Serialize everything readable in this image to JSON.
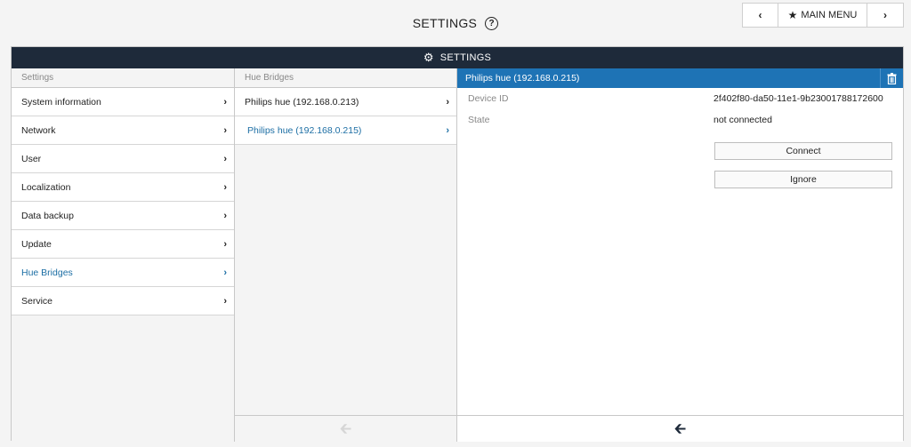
{
  "header": {
    "title": "SETTINGS",
    "help_icon": "?",
    "main_menu_label": "MAIN MENU",
    "prev_icon": "‹",
    "next_icon": "›"
  },
  "bar": {
    "title": "SETTINGS"
  },
  "settings_col": {
    "header": "Settings",
    "items": [
      {
        "label": "System information",
        "active": false
      },
      {
        "label": "Network",
        "active": false
      },
      {
        "label": "User",
        "active": false
      },
      {
        "label": "Localization",
        "active": false
      },
      {
        "label": "Data backup",
        "active": false
      },
      {
        "label": "Update",
        "active": false
      },
      {
        "label": "Hue Bridges",
        "active": true
      },
      {
        "label": "Service",
        "active": false
      }
    ]
  },
  "bridges_col": {
    "header": "Hue Bridges",
    "items": [
      {
        "label": "Philips hue (192.168.0.213)",
        "active": false
      },
      {
        "label": "Philips hue (192.168.0.215)",
        "active": true
      }
    ]
  },
  "detail": {
    "title": "Philips hue (192.168.0.215)",
    "device_id_label": "Device ID",
    "device_id_value": "2f402f80-da50-11e1-9b23001788172600",
    "state_label": "State",
    "state_value": "not connected",
    "connect_label": "Connect",
    "ignore_label": "Ignore"
  },
  "colors": {
    "bar": "#1e2a3a",
    "accent": "#1e73b5",
    "active_text": "#1c6ea4"
  },
  "icons": {
    "gear": "gear-icon",
    "trash": "trash-icon",
    "back": "back-arrow-icon",
    "star": "star-icon",
    "chevron": "chevron-right-icon"
  }
}
